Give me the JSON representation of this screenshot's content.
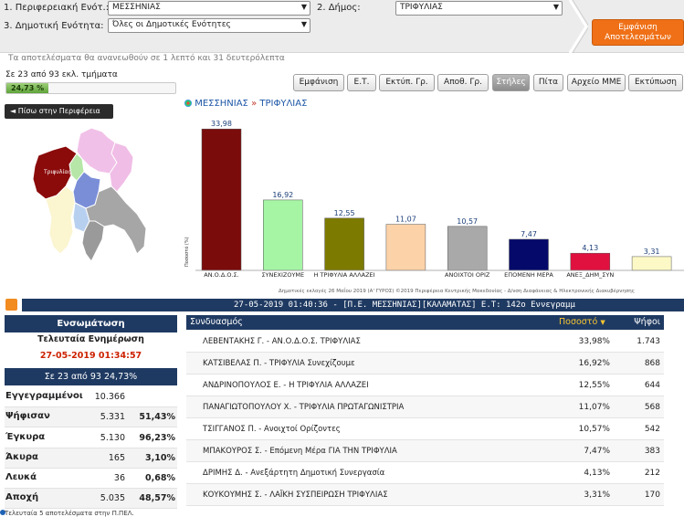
{
  "filters": {
    "region_label": "1. Περιφερειακή Ενότ.:",
    "region_value": "ΜΕΣΣΗΝΙΑΣ",
    "municipality_label": "2. Δήμος:",
    "municipality_value": "ΤΡΙΦΥΛΙΑΣ",
    "unit_label": "3. Δημοτική Ενότητα:",
    "unit_value": "Όλες οι Δημοτικές Ενότητες",
    "show_button": "Εμφάνιση Αποτελεσμάτων",
    "refresh_note": "Τα αποτελέσματα θα ανανεωθούν σε 1 λεπτό και 31 δευτερόλεπτα"
  },
  "progress": {
    "text": "Σε 23 από 93 εκλ. τμήματα",
    "label": "24,73 %",
    "fraction": 0.2473
  },
  "tabs": [
    "Εμφάνιση",
    "Ε.Τ.",
    "Εκτύπ. Γρ.",
    "Αποθ. Γρ.",
    "Στήλες",
    "Πίτα",
    "Αρχείο ΜΜΕ",
    "Εκτύπωση"
  ],
  "active_tab": "Στήλες",
  "back_button": "◄ Πίσω στην Περιφέρεια",
  "map": {
    "selected_label": "Τριφυλίας"
  },
  "breadcrumb": {
    "region": "ΜΕΣΣΗΝΙΑΣ",
    "sep": "»",
    "municipality": "ΤΡΙΦΥΛΙΑΣ"
  },
  "chart_data": {
    "type": "bar",
    "categories": [
      "ΑΝ.Ο.Δ.Ο.Σ.",
      "ΣΥΝΕΧΙΖΟΥΜΕ",
      "Η ΤΡΙΦΥΛΙΑ ΑΛΛΑΖΕΙ",
      "ΤΡΙΦΥΛΙΑ ΠΡΩΤΑΓΩΝΙΣΤΡΙΑ",
      "ΑΝΟΙΧΤΟΙ ΟΡΙΖ",
      "ΕΠΟΜΕΝΗ ΜΕΡΑ",
      "ΑΝΕΞ_ΔΗΜ_ΣΥΝ",
      "ΛΑΙΚΗ ΣΥΣΠΕΙΡΩΣΗ"
    ],
    "tick_labels": [
      "ΑΝ.Ο.Δ.Ο.Σ.",
      "ΣΥΝΕΧΙΖΟΥΜΕ",
      "Η ΤΡΙΦΥΛΙΑ ΑΛΛΑΖΕΙ",
      "",
      "ΑΝΟΙΧΤΟΙ ΟΡΙΖ",
      "ΕΠΟΜΕΝΗ ΜΕΡΑ",
      "ΑΝΕΞ_ΔΗΜ_ΣΥΝ",
      ""
    ],
    "values": [
      33.98,
      16.92,
      12.55,
      11.07,
      10.57,
      7.47,
      4.13,
      3.31
    ],
    "data_labels": [
      "33,98",
      "16,92",
      "12,55",
      "11,07",
      "10,57",
      "7,47",
      "4,13",
      "3,31"
    ],
    "colors": [
      "#7b0c0c",
      "#a5f5a5",
      "#7d7a00",
      "#fcd2a8",
      "#a9a9a9",
      "#050a6a",
      "#e0103f",
      "#fdf9c6"
    ],
    "ylabel": "Ποσοστό (%)",
    "ylim": [
      0,
      36
    ],
    "title": "",
    "source": "Δημοτικές εκλογές 26 Μαΐου 2019 (Α' ΓΥΡΟΣ) ©2019 Περιφέρεια Κεντρικής Μακεδονίας - Δ/νση Διαφάνειας & Ηλεκτρονικής Διακυβέρνησης"
  },
  "ticker": "27-05-2019 01:40:36 - [Π.Ε. ΜΕΣΣΗΝΙΑΣ][ΚΑΛΑΜΑΤΑΣ] Ε.Τ: 142ο Εννεγραμμ",
  "stats": {
    "header": "Ενσωμάτωση",
    "update_label": "Τελευταία Ενημέρωση",
    "update_time": "27-05-2019 01:34:57",
    "count_text": "Σε 23 από 93 24,73%",
    "rows": [
      {
        "label": "Εγγεγραμμένοι",
        "num": "10.366",
        "pct": ""
      },
      {
        "label": "Ψήφισαν",
        "num": "5.331",
        "pct": "51,43%"
      },
      {
        "label": "Έγκυρα",
        "num": "5.130",
        "pct": "96,23%"
      },
      {
        "label": "Άκυρα",
        "num": "165",
        "pct": "3,10%"
      },
      {
        "label": "Λευκά",
        "num": "36",
        "pct": "0,68%"
      },
      {
        "label": "Αποχή",
        "num": "5.035",
        "pct": "48,57%"
      }
    ]
  },
  "table": {
    "col_party": "Συνδυασμός",
    "col_pct": "Ποσοστό",
    "col_votes": "Ψήφοι",
    "rows": [
      {
        "name": "ΛΕΒΕΝΤΑΚΗΣ Γ. - ΑΝ.Ο.Δ.Ο.Σ. ΤΡΙΦΥΛΙΑΣ",
        "pct": "33,98%",
        "votes": "1.743"
      },
      {
        "name": "ΚΑΤΣΙΒΕΛΑΣ Π. - ΤΡΙΦΥΛΙΑ Συνεχίζουμε",
        "pct": "16,92%",
        "votes": "868"
      },
      {
        "name": "ΑΝΔΡΙΝΟΠΟΥΛΟΣ Ε. - Η ΤΡΙΦΥΛΙΑ ΑΛΛΑΖΕΙ",
        "pct": "12,55%",
        "votes": "644"
      },
      {
        "name": "ΠΑΝΑΓΙΩΤΟΠΟΥΛΟΥ Χ. - ΤΡΙΦΥΛΙΑ ΠΡΩΤΑΓΩΝΙΣΤΡΙΑ",
        "pct": "11,07%",
        "votes": "568"
      },
      {
        "name": "ΤΣΙΓΓΑΝΟΣ Π. - Ανοιχτοί Ορίζοντες",
        "pct": "10,57%",
        "votes": "542"
      },
      {
        "name": "ΜΠΑΚΟΥΡΟΣ Σ. - Επόμενη Μέρα ΓΙΑ ΤΗΝ ΤΡΙΦΥΛΙΑ",
        "pct": "7,47%",
        "votes": "383"
      },
      {
        "name": "ΔΡΙΜΗΣ Δ. - Ανεξάρτητη Δημοτική Συνεργασία",
        "pct": "4,13%",
        "votes": "212"
      },
      {
        "name": "ΚΟΥΚΟΥΜΗΣ Σ. - ΛΑΪΚΗ ΣΥΣΠΕΙΡΩΣΗ ΤΡΙΦΥΛΙΑΣ",
        "pct": "3,31%",
        "votes": "170"
      }
    ]
  },
  "footnote": "Τελευταία 5 αποτελέσματα στην Π.ΠΕΛ."
}
